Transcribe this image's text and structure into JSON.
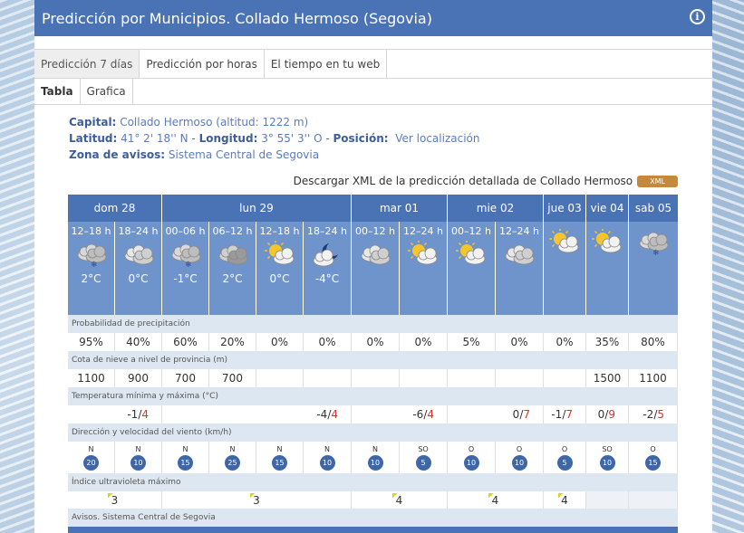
{
  "title": "Predicción por Municipios. Collado Hermoso (Segovia)",
  "tabs": [
    "Predicción 7 días",
    "Predicción por horas",
    "El tiempo en tu web"
  ],
  "subtabs": [
    "Tabla",
    "Grafica"
  ],
  "info": {
    "capital_label": "Capital:",
    "capital_value": "Collado Hermoso (altitud: 1222 m)",
    "lat_label": "Latitud:",
    "lat_value": "41° 2' 18'' N",
    "lon_label": "Longitud:",
    "lon_value": "3° 55' 3'' O",
    "pos_label": "Posición:",
    "pos_link": "Ver localización",
    "zona_label": "Zona de avisos:",
    "zona_value": "Sistema Central de Segovia"
  },
  "xml_text": "Descargar XML de la predicción detallada de Collado Hermoso",
  "xml_button": "XML",
  "days": [
    {
      "label": "dom 28",
      "span": 2
    },
    {
      "label": "lun 29",
      "span": 4
    },
    {
      "label": "mar 01",
      "span": 2
    },
    {
      "label": "mie 02",
      "span": 2
    },
    {
      "label": "jue 03",
      "span": 1
    },
    {
      "label": "vie 04",
      "span": 1
    },
    {
      "label": "sab 05",
      "span": 1
    }
  ],
  "periods": [
    {
      "h": "12–18 h",
      "icon": "cloud-snow-icon",
      "t": "2°C"
    },
    {
      "h": "18–24 h",
      "icon": "cloudy-icon",
      "t": "0°C"
    },
    {
      "h": "00–06 h",
      "icon": "cloud-snow-icon",
      "t": "-1°C"
    },
    {
      "h": "06–12 h",
      "icon": "overcast-icon",
      "t": "2°C"
    },
    {
      "h": "12–18 h",
      "icon": "sun-cloud-icon",
      "t": "0°C"
    },
    {
      "h": "18–24 h",
      "icon": "moon-cloud-icon",
      "t": "-4°C"
    },
    {
      "h": "00–12 h",
      "icon": "cloudy-icon",
      "t": ""
    },
    {
      "h": "12–24 h",
      "icon": "sun-cloud-icon",
      "t": ""
    },
    {
      "h": "00–12 h",
      "icon": "sun-cloud-icon",
      "t": ""
    },
    {
      "h": "12–24 h",
      "icon": "cloudy-icon",
      "t": ""
    },
    {
      "h": "",
      "icon": "sun-cloud-icon",
      "t": ""
    },
    {
      "h": "",
      "icon": "sun-cloud-icon",
      "t": ""
    },
    {
      "h": "",
      "icon": "cloud-snow-icon",
      "t": ""
    }
  ],
  "labels": {
    "precip": "Probabilidad de precipitación",
    "snow": "Cota de nieve a nivel de provincia (m)",
    "temp": "Temperatura mínima y máxima (°C)",
    "wind": "Dirección y velocidad del viento (km/h)",
    "uv": "Índice ultravioleta máximo",
    "avisos": "Avisos. Sistema Central de Segovia"
  },
  "precip": [
    "95%",
    "40%",
    "60%",
    "20%",
    "0%",
    "0%",
    "0%",
    "0%",
    "5%",
    "0%",
    "0%",
    "35%",
    "80%"
  ],
  "snow": [
    "1100",
    "900",
    "700",
    "700",
    "",
    "",
    "",
    "",
    "",
    "",
    "",
    "1500",
    "1100"
  ],
  "temps": [
    {
      "min": "-1",
      "max": "4"
    },
    {
      "min": "-4",
      "max": "4"
    },
    {
      "min": "-6",
      "max": "4"
    },
    {
      "min": "0",
      "max": "7"
    },
    {
      "min": "-1",
      "max": "7"
    },
    {
      "min": "0",
      "max": "9"
    },
    {
      "min": "-2",
      "max": "5"
    }
  ],
  "wind": [
    {
      "d": "N",
      "s": "20"
    },
    {
      "d": "N",
      "s": "10"
    },
    {
      "d": "N",
      "s": "15"
    },
    {
      "d": "N",
      "s": "25"
    },
    {
      "d": "N",
      "s": "15"
    },
    {
      "d": "N",
      "s": "10"
    },
    {
      "d": "N",
      "s": "10"
    },
    {
      "d": "SO",
      "s": "5"
    },
    {
      "d": "O",
      "s": "10"
    },
    {
      "d": "O",
      "s": "10"
    },
    {
      "d": "O",
      "s": "5"
    },
    {
      "d": "SO",
      "s": "10"
    },
    {
      "d": "O",
      "s": "15"
    }
  ],
  "uv": [
    "3",
    "3",
    "4",
    "4",
    "4",
    "",
    ""
  ],
  "avisos": [
    "green",
    "green",
    "yellow",
    "",
    "",
    "",
    ""
  ],
  "colors": {
    "header": "#4a73b5",
    "subheader": "#6f94cc",
    "warn_yellow": "#f0e020",
    "ok_green": "#b8ef8a",
    "max_red": "#d9302a"
  }
}
